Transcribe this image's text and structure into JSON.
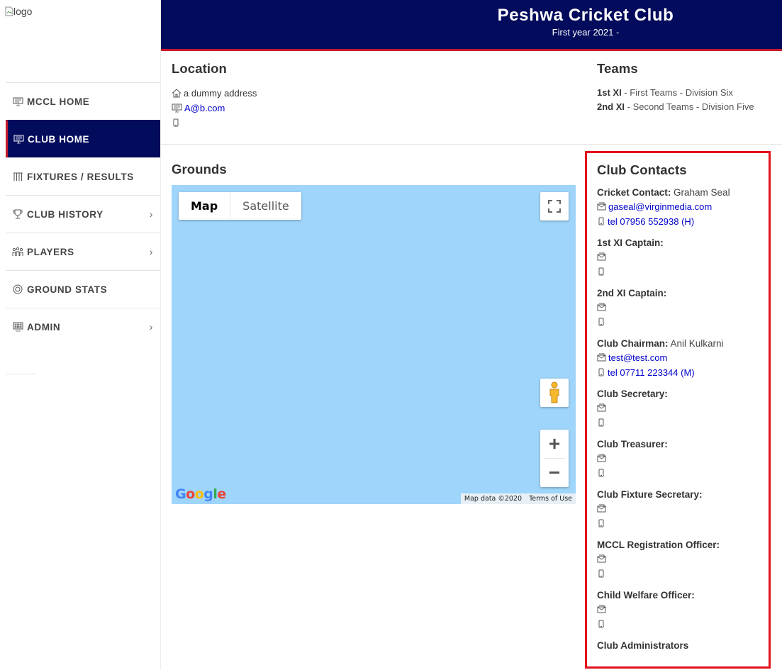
{
  "sidebar": {
    "logo_alt": "logo",
    "items": [
      {
        "label": "MCCL HOME",
        "icon": "monitor-icon",
        "chevron": false,
        "active": false
      },
      {
        "label": "CLUB HOME",
        "icon": "monitor-icon",
        "chevron": false,
        "active": true
      },
      {
        "label": "FIXTURES / RESULTS",
        "icon": "wickets-icon",
        "chevron": false,
        "active": false
      },
      {
        "label": "CLUB HISTORY",
        "icon": "trophy-icon",
        "chevron": true,
        "active": false
      },
      {
        "label": "PLAYERS",
        "icon": "players-icon",
        "chevron": true,
        "active": false
      },
      {
        "label": "GROUND STATS",
        "icon": "ball-icon",
        "chevron": false,
        "active": false
      },
      {
        "label": "ADMIN",
        "icon": "admin-icon",
        "chevron": true,
        "active": false
      }
    ],
    "chevron_glyph": "›"
  },
  "header": {
    "title": "Peshwa Cricket Club",
    "subtitle": "First year 2021 -"
  },
  "location": {
    "heading": "Location",
    "address": "a dummy address",
    "email": "A@b.com"
  },
  "teams": {
    "heading": "Teams",
    "items": [
      {
        "name": "1st XI",
        "desc": " - First Teams - Division Six"
      },
      {
        "name": "2nd XI",
        "desc": " - Second Teams - Division Five"
      }
    ]
  },
  "grounds": {
    "heading": "Grounds",
    "map": {
      "tab_map": "Map",
      "tab_satellite": "Satellite",
      "zoom_in": "+",
      "zoom_out": "−",
      "logo": "Google",
      "map_data": "Map data ©2020",
      "terms": "Terms of Use"
    }
  },
  "contacts": {
    "heading": "Club Contacts",
    "items": [
      {
        "role": "Cricket Contact:",
        "name": " Graham Seal",
        "email": "gaseal@virginmedia.com",
        "phone": "tel 07956 552938 (H)"
      },
      {
        "role": "1st XI Captain:",
        "name": "",
        "email": "",
        "phone": ""
      },
      {
        "role": "2nd XI Captain:",
        "name": "",
        "email": "",
        "phone": ""
      },
      {
        "role": "Club Chairman:",
        "name": " Anil Kulkarni",
        "email": "test@test.com",
        "phone": "tel 07711 223344 (M)"
      },
      {
        "role": "Club Secretary:",
        "name": "",
        "email": "",
        "phone": ""
      },
      {
        "role": "Club Treasurer:",
        "name": "",
        "email": "",
        "phone": ""
      },
      {
        "role": "Club Fixture Secretary:",
        "name": "",
        "email": "",
        "phone": ""
      },
      {
        "role": "MCCL Registration Officer:",
        "name": "",
        "email": "",
        "phone": ""
      },
      {
        "role": "Child Welfare Officer:",
        "name": "",
        "email": "",
        "phone": ""
      },
      {
        "role": "Club Administrators",
        "name": "",
        "email": "",
        "phone": ""
      }
    ]
  },
  "colors": {
    "header_bg": "#020b5c",
    "accent_red": "#c41a2a",
    "highlight_border": "#e3101c",
    "map_water": "#9fd5fa",
    "link": "#0000cc"
  }
}
